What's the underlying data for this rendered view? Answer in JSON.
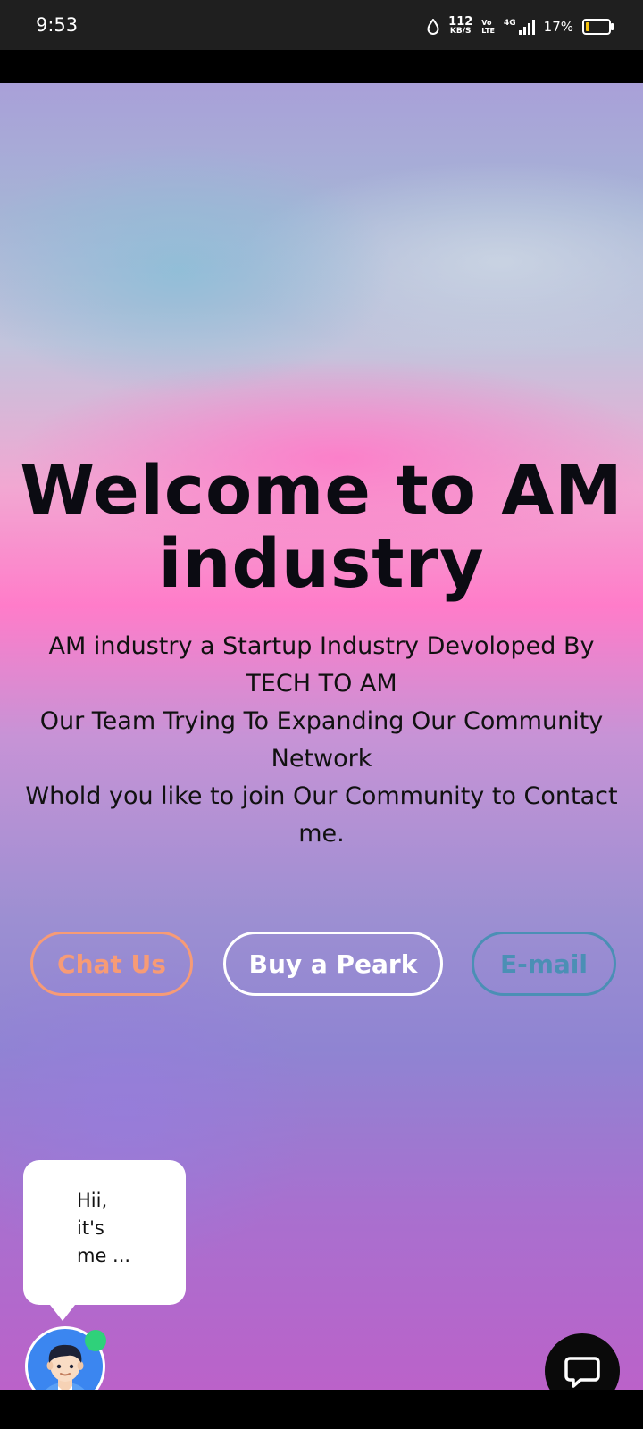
{
  "status_bar": {
    "time": "9:53",
    "speed_value": "112",
    "speed_unit": "KB/S",
    "volte_top": "Vo",
    "volte_bottom": "LTE",
    "network": "4G",
    "battery_percent": "17%",
    "battery_level": 0.17
  },
  "hero": {
    "headline": "Welcome to AM industry",
    "description_lines": [
      "AM industry a Startup Industry Devoloped By TECH TO AM",
      "Our Team Trying To Expanding Our Community Network",
      "Whold you like to join Our Community to Contact me."
    ],
    "buttons": {
      "chat_label": "Chat Us",
      "buy_label": "Buy a Peark",
      "mail_label": "E-mail"
    }
  },
  "chat_widget": {
    "greeting_lines": [
      "Hii,",
      "it's",
      "me ..."
    ],
    "avatar_icon": "user-avatar-icon",
    "fab_icon": "chat-bubble-icon",
    "online": true
  },
  "colors": {
    "chat_button": "#f79b76",
    "buy_button": "#ffffff",
    "mail_button": "#4b8fb5",
    "online_dot": "#2fd17a"
  }
}
